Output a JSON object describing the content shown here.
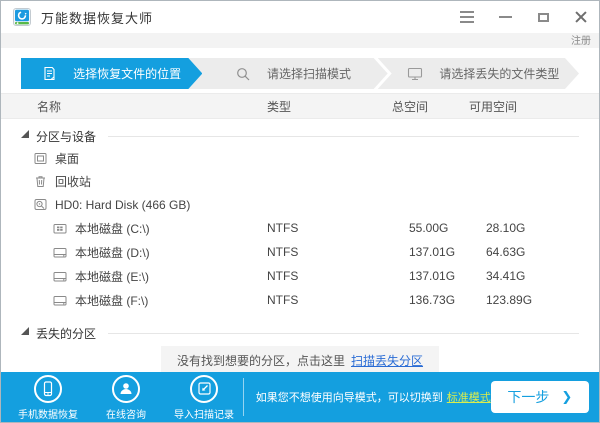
{
  "window": {
    "title": "万能数据恢复大师",
    "register_label": "注册"
  },
  "steps": [
    {
      "label": "选择恢复文件的位置",
      "icon": "document-icon",
      "active": true
    },
    {
      "label": "请选择扫描模式",
      "icon": "search-icon",
      "active": false
    },
    {
      "label": "请选择丢失的文件类型",
      "icon": "monitor-icon",
      "active": false
    }
  ],
  "table": {
    "headers": {
      "name": "名称",
      "type": "类型",
      "total": "总空间",
      "free": "可用空间"
    }
  },
  "sections": {
    "devices": "分区与设备",
    "lost": "丢失的分区"
  },
  "tree": [
    {
      "label": "桌面",
      "icon": "desktop-icon"
    },
    {
      "label": "回收站",
      "icon": "recycle-bin-icon"
    },
    {
      "label": "HD0: Hard Disk (466 GB)",
      "icon": "harddisk-icon"
    }
  ],
  "drives": [
    {
      "name": "本地磁盘 (C:\\)",
      "type": "NTFS",
      "total": "55.00G",
      "free": "28.10G"
    },
    {
      "name": "本地磁盘 (D:\\)",
      "type": "NTFS",
      "total": "137.01G",
      "free": "64.63G"
    },
    {
      "name": "本地磁盘 (E:\\)",
      "type": "NTFS",
      "total": "137.01G",
      "free": "34.41G"
    },
    {
      "name": "本地磁盘 (F:\\)",
      "type": "NTFS",
      "total": "136.73G",
      "free": "123.89G"
    }
  ],
  "lost_partition": {
    "message": "没有找到想要的分区，点击这里",
    "link": "扫描丢失分区"
  },
  "footer": {
    "actions": [
      {
        "label": "手机数据恢复",
        "icon": "phone-icon"
      },
      {
        "label": "在线咨询",
        "icon": "person-icon"
      },
      {
        "label": "导入扫描记录",
        "icon": "import-icon"
      }
    ],
    "hint": "如果您不想使用向导模式，可以切换到",
    "hint_link": "标准模式",
    "next_button": "下一步"
  },
  "colors": {
    "accent": "#149fdf",
    "step_inactive_bg": "#ececec",
    "header_bg": "#f4f4f4",
    "link_blue": "#2a6cd5",
    "link_lime": "#d9ed4e"
  }
}
